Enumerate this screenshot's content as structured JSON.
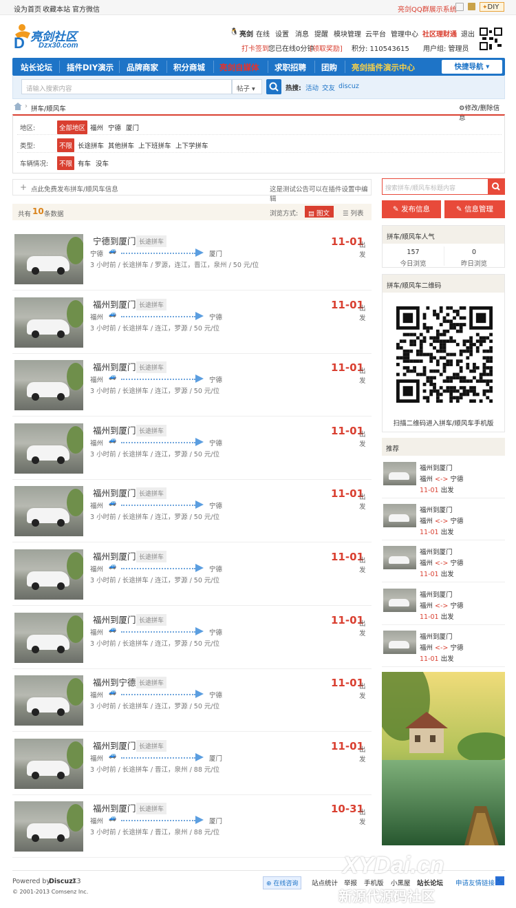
{
  "topbar": {
    "left": [
      "设为首页",
      "收藏本站",
      "官方微信"
    ],
    "right_link": "亮剑QQ群展示系统",
    "diy": "DIY"
  },
  "logo": {
    "name": "亮剑社区",
    "domain": "Dzx30.com"
  },
  "user": {
    "name": "亮剑",
    "status": "在线",
    "links": [
      "设置",
      "消息",
      "提醒",
      "模块管理",
      "云平台",
      "管理中心"
    ],
    "finance": "社区理财通",
    "logout": "退出",
    "signin": "打卡签到",
    "online_time": "您已在线0分钟",
    "reward": "[领取奖励]",
    "points": "积分: 110543615",
    "group": "用户组: 管理员"
  },
  "nav": {
    "items": [
      "站长论坛",
      "插件DIY演示",
      "品牌商家",
      "积分商城",
      "亮剑自媒体",
      "求职招聘",
      "团购",
      "亮剑插件演示中心"
    ],
    "quick": "快捷导航"
  },
  "search": {
    "placeholder": "请输入搜索内容",
    "type": "帖子",
    "hot_label": "热搜:",
    "hot": [
      "活动",
      "交友",
      "discuz"
    ]
  },
  "breadcrumb": {
    "current": "拼车/顺风车",
    "edit": "修改/删除信息"
  },
  "filters": {
    "region": {
      "label": "地区:",
      "options": [
        "全部地区",
        "福州",
        "宁德",
        "厦门"
      ]
    },
    "type": {
      "label": "类型:",
      "options": [
        "不限",
        "长途拼车",
        "其他拼车",
        "上下班拼车",
        "上下学拼车"
      ]
    },
    "car": {
      "label": "车辆情况:",
      "options": [
        "不限",
        "有车",
        "没车"
      ]
    }
  },
  "publish": {
    "text": "点此免费发布拼车/顺风车信息",
    "notice": "这是测试公告可以在插件设置中编辑"
  },
  "count": {
    "prefix": "共有",
    "num": "10",
    "suffix": "条数据",
    "view_label": "浏览方式:",
    "view_pic": "图文",
    "view_list": "列表"
  },
  "listings": [
    {
      "title": "宁德到厦门",
      "tag": "长途拼车",
      "from": "宁德",
      "to": "厦门",
      "meta": "3 小时前 / 长途拼车 / 罗源，连江，晋江，泉州 / 50 元/位",
      "date": "11-01",
      "dep": "出发"
    },
    {
      "title": "福州到厦门",
      "tag": "长途拼车",
      "from": "福州",
      "to": "宁德",
      "meta": "3 小时前 / 长途拼车 / 连江，罗源 / 50 元/位",
      "date": "11-01",
      "dep": "出发"
    },
    {
      "title": "福州到厦门",
      "tag": "长途拼车",
      "from": "福州",
      "to": "宁德",
      "meta": "3 小时前 / 长途拼车 / 连江，罗源 / 50 元/位",
      "date": "11-01",
      "dep": "出发"
    },
    {
      "title": "福州到厦门",
      "tag": "长途拼车",
      "from": "福州",
      "to": "宁德",
      "meta": "3 小时前 / 长途拼车 / 连江，罗源 / 50 元/位",
      "date": "11-01",
      "dep": "出发"
    },
    {
      "title": "福州到厦门",
      "tag": "长途拼车",
      "from": "福州",
      "to": "宁德",
      "meta": "3 小时前 / 长途拼车 / 连江，罗源 / 50 元/位",
      "date": "11-01",
      "dep": "出发"
    },
    {
      "title": "福州到厦门",
      "tag": "长途拼车",
      "from": "福州",
      "to": "宁德",
      "meta": "3 小时前 / 长途拼车 / 连江，罗源 / 50 元/位",
      "date": "11-01",
      "dep": "出发"
    },
    {
      "title": "福州到厦门",
      "tag": "长途拼车",
      "from": "福州",
      "to": "宁德",
      "meta": "3 小时前 / 长途拼车 / 连江，罗源 / 50 元/位",
      "date": "11-01",
      "dep": "出发"
    },
    {
      "title": "福州到宁德",
      "tag": "长途拼车",
      "from": "福州",
      "to": "宁德",
      "meta": "3 小时前 / 长途拼车 / 连江，罗源 / 50 元/位",
      "date": "11-01",
      "dep": "出发"
    },
    {
      "title": "福州到厦门",
      "tag": "长途拼车",
      "from": "福州",
      "to": "厦门",
      "meta": "3 小时前 / 长途拼车 / 晋江，泉州 / 88 元/位",
      "date": "11-01",
      "dep": "出发"
    },
    {
      "title": "福州到厦门",
      "tag": "长途拼车",
      "from": "福州",
      "to": "厦门",
      "meta": "3 小时前 / 长途拼车 / 晋江，泉州 / 88 元/位",
      "date": "10-31",
      "dep": "出发"
    }
  ],
  "sidebar": {
    "search_placeholder": "搜索拼车/顺风车标题内容",
    "btn_publish": "发布信息",
    "btn_manage": "信息管理",
    "stats": {
      "title": "拼车/顺风车人气",
      "today_num": "157",
      "today_label": "今日浏览",
      "yesterday_num": "0",
      "yesterday_label": "昨日浏览"
    },
    "qr": {
      "title": "拼车/顺风车二维码",
      "caption": "扫描二维码进入拼车/顺风车手机版"
    },
    "rec_title": "推荐",
    "recs": [
      {
        "title": "福州到厦门",
        "from": "福州",
        "arrow": "<->",
        "to": "宁德",
        "date": "11-01",
        "dep": "出发"
      },
      {
        "title": "福州到厦门",
        "from": "福州",
        "arrow": "<->",
        "to": "宁德",
        "date": "11-01",
        "dep": "出发"
      },
      {
        "title": "福州到厦门",
        "from": "福州",
        "arrow": "<->",
        "to": "宁德",
        "date": "11-01",
        "dep": "出发"
      },
      {
        "title": "福州到厦门",
        "from": "福州",
        "arrow": "<->",
        "to": "宁德",
        "date": "11-01",
        "dep": "出发"
      },
      {
        "title": "福州到厦门",
        "from": "福州",
        "arrow": "<->",
        "to": "宁德",
        "date": "11-01",
        "dep": "出发"
      }
    ]
  },
  "footer": {
    "powered": "Powered by",
    "brand": "Discuz!",
    "ver": "X3",
    "copy": "© 2001-2013 Comsenz Inc.",
    "links": [
      "在线咨询",
      "站点统计",
      "举报",
      "手机版",
      "小黑屋",
      "站长论坛",
      "申请友情链接"
    ],
    "watermark": "XYDai.cn",
    "watermark2": "新源代源码社区"
  },
  "colors": {
    "nav": "#1e74c7",
    "accent": "#d93f30"
  }
}
